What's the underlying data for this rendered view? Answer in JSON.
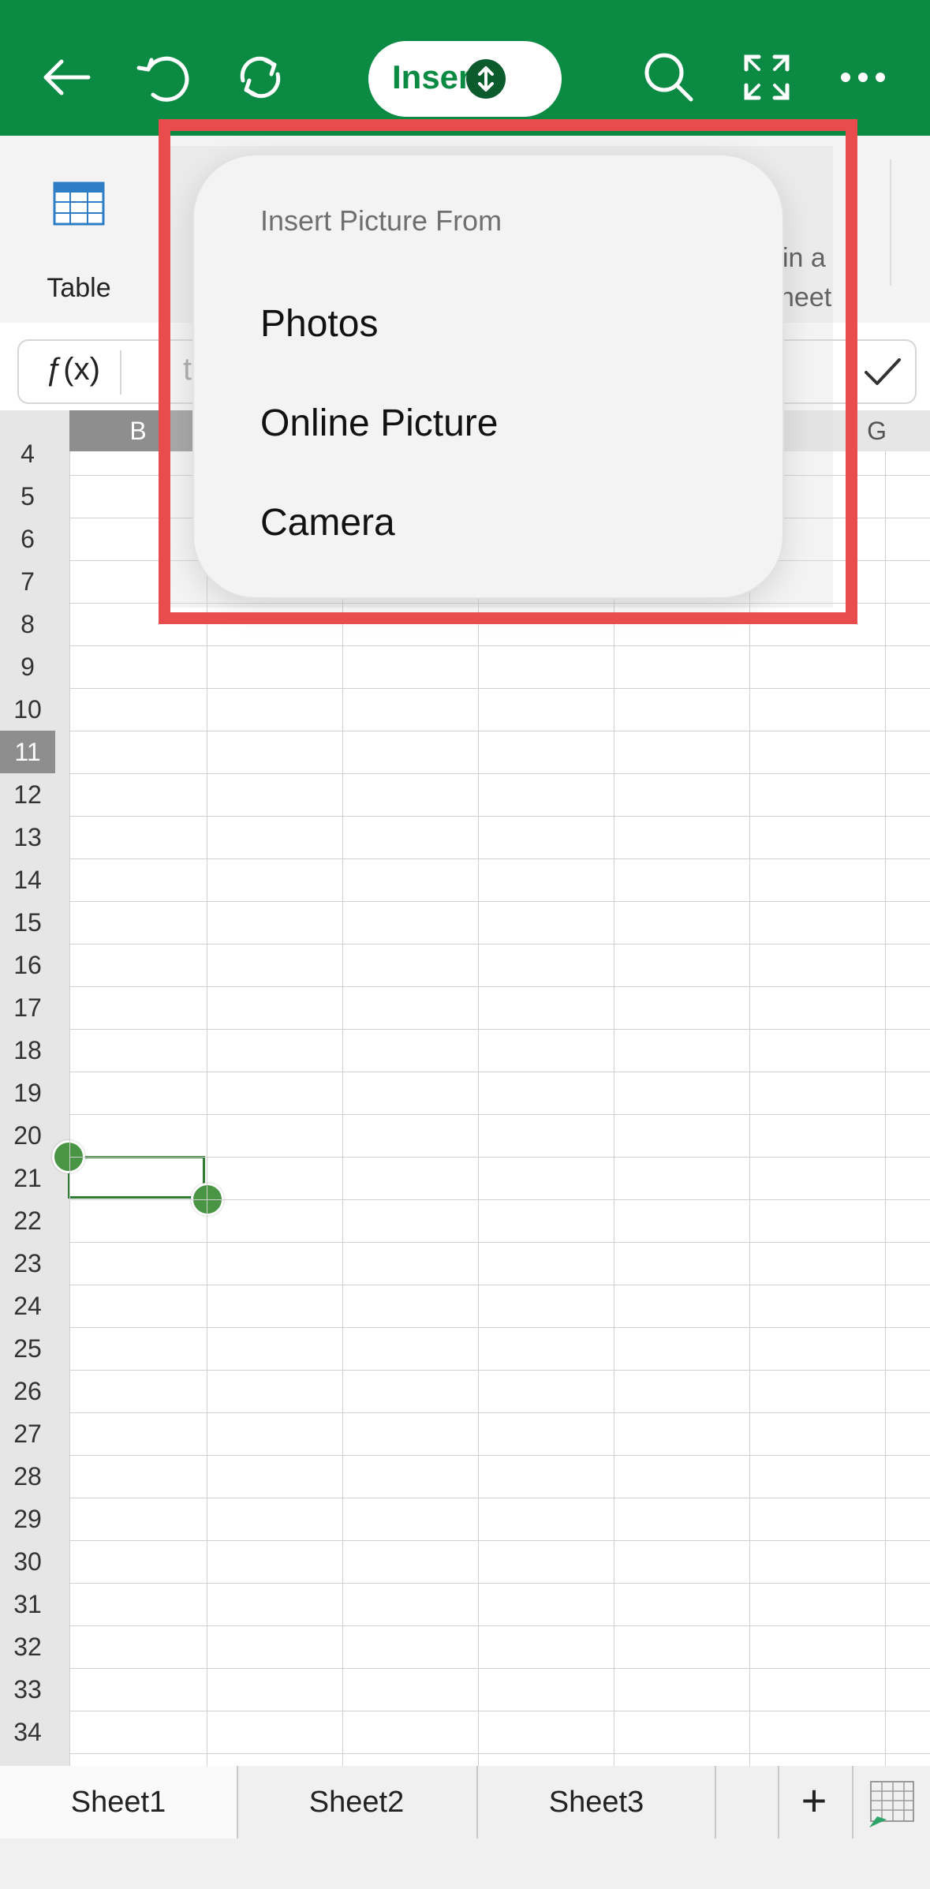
{
  "toolbar": {
    "insert_label": "Insert",
    "icons": [
      "back-icon",
      "undo-icon",
      "redo-icon",
      "search-icon",
      "fullscreen-icon",
      "more-icon"
    ],
    "bg_color": "#0a8a43"
  },
  "ribbon": {
    "table_label": "Table",
    "partial_label_line1": "in a",
    "partial_label_line2": "heet"
  },
  "formula_bar": {
    "fx_label": "ƒ(x)",
    "partial_text": "t"
  },
  "grid": {
    "columns": [
      "B",
      "G"
    ],
    "rows": [
      "4",
      "5",
      "6",
      "7",
      "8",
      "9",
      "10",
      "11",
      "12",
      "13",
      "14",
      "15",
      "16",
      "17",
      "18",
      "19",
      "20",
      "21",
      "22",
      "23",
      "24",
      "25",
      "26",
      "27",
      "28",
      "29",
      "30",
      "31",
      "32",
      "33",
      "34"
    ],
    "active_row": "11",
    "selection_color": "#2e7d32"
  },
  "popup": {
    "title": "Insert Picture From",
    "items": [
      "Photos",
      "Online Picture",
      "Camera"
    ]
  },
  "sheet_tabs": [
    "Sheet1",
    "Sheet2",
    "Sheet3"
  ],
  "highlight_color": "#e84c4c"
}
